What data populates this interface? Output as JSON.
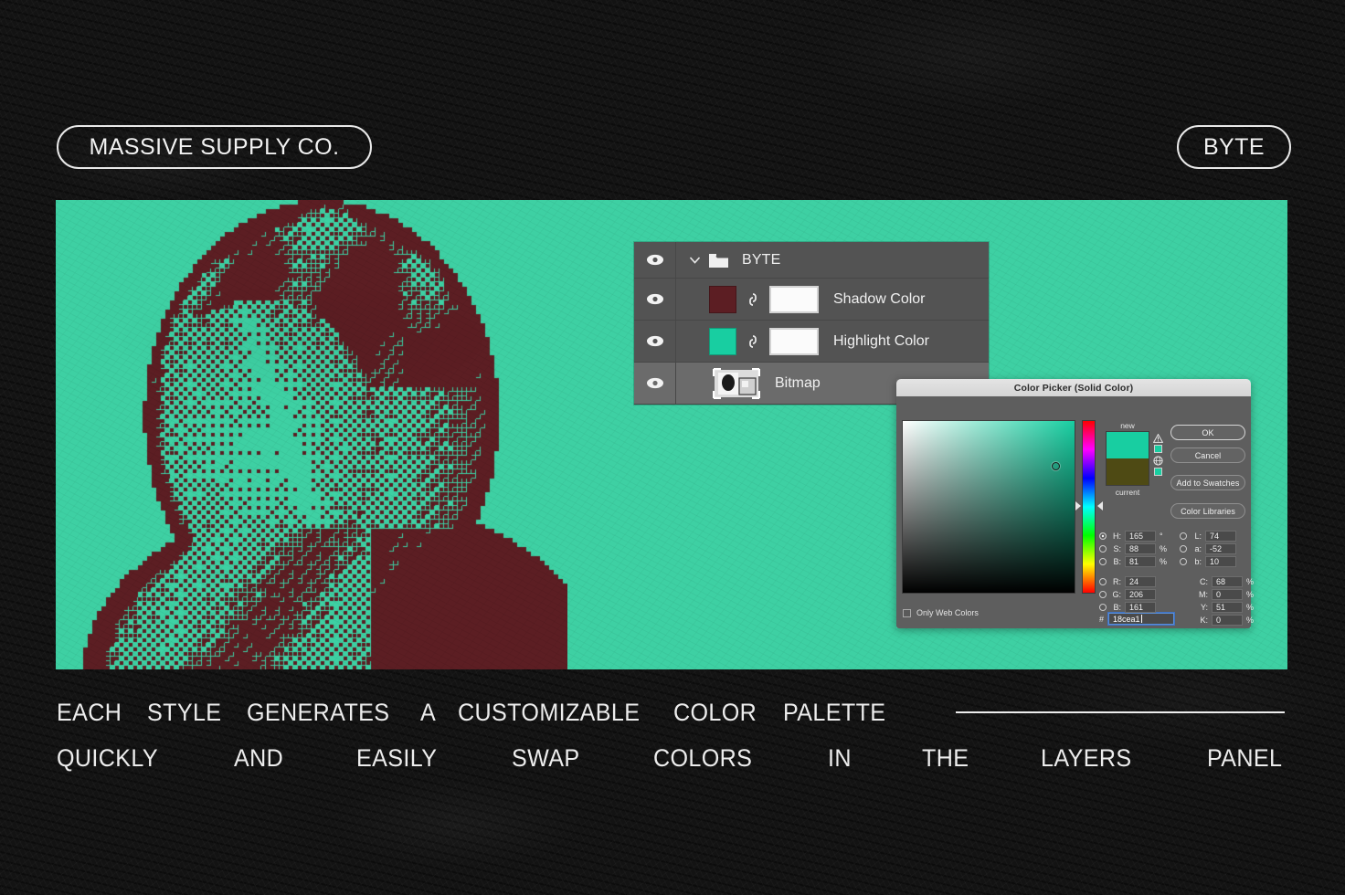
{
  "header": {
    "brand_label": "MASSIVE SUPPLY CO.",
    "style_label": "BYTE"
  },
  "artwork": {
    "highlight_color": "#3ed0a3",
    "shadow_color": "#5c1e23",
    "description": "halftone dithered portrait"
  },
  "layers_panel": {
    "rows": [
      {
        "name": "BYTE",
        "type": "group",
        "visible": true,
        "expanded": true,
        "icon": "folder-icon",
        "chevron": "chevron-down-icon"
      },
      {
        "name": "Shadow Color",
        "type": "solid-color",
        "visible": true,
        "swatch": "#5c1e23",
        "has_mask": true,
        "linked": true
      },
      {
        "name": "Highlight Color",
        "type": "solid-color",
        "visible": true,
        "swatch": "#18cea1",
        "has_mask": true,
        "linked": true
      },
      {
        "name": "Bitmap",
        "type": "smart-object",
        "visible": true,
        "selected": true,
        "thumbnail": "bitmap-thumbnail-icon"
      }
    ]
  },
  "color_picker": {
    "title": "Color Picker (Solid Color)",
    "buttons": {
      "ok": "OK",
      "cancel": "Cancel",
      "add_to_swatches": "Add to Swatches",
      "color_libraries": "Color Libraries"
    },
    "swatches": {
      "new_label": "new",
      "current_label": "current",
      "new_color": "#18cea1",
      "current_color": "#4e4a14"
    },
    "only_web_colors": {
      "label": "Only Web Colors",
      "checked": false
    },
    "selected_model": "H",
    "hsb": [
      {
        "key": "H",
        "value": "165",
        "unit": "°",
        "selected": true
      },
      {
        "key": "S",
        "value": "88",
        "unit": "%",
        "selected": false
      },
      {
        "key": "B",
        "value": "81",
        "unit": "%",
        "selected": false
      }
    ],
    "rgb": [
      {
        "key": "R",
        "value": "24",
        "unit": "",
        "selected": false
      },
      {
        "key": "G",
        "value": "206",
        "unit": "",
        "selected": false
      },
      {
        "key": "B",
        "value": "161",
        "unit": "",
        "selected": false
      }
    ],
    "lab": [
      {
        "key": "L",
        "value": "74",
        "unit": "",
        "selected": false
      },
      {
        "key": "a",
        "value": "-52",
        "unit": "",
        "selected": false
      },
      {
        "key": "b",
        "value": "10",
        "unit": "",
        "selected": false
      }
    ],
    "cmyk": [
      {
        "key": "C",
        "value": "68",
        "unit": "%"
      },
      {
        "key": "M",
        "value": "0",
        "unit": "%"
      },
      {
        "key": "Y",
        "value": "51",
        "unit": "%"
      },
      {
        "key": "K",
        "value": "0",
        "unit": "%"
      }
    ],
    "hex_symbol": "#",
    "hex_value": "18cea1"
  },
  "caption": {
    "line1": [
      "EACH",
      "STYLE",
      "GENERATES",
      "A",
      "CUSTOMIZABLE",
      "COLOR",
      "PALETTE"
    ],
    "line2": [
      "QUICKLY",
      "AND",
      "EASILY",
      "SWAP",
      "COLORS",
      "IN",
      "THE",
      "LAYERS",
      "PANEL"
    ]
  }
}
